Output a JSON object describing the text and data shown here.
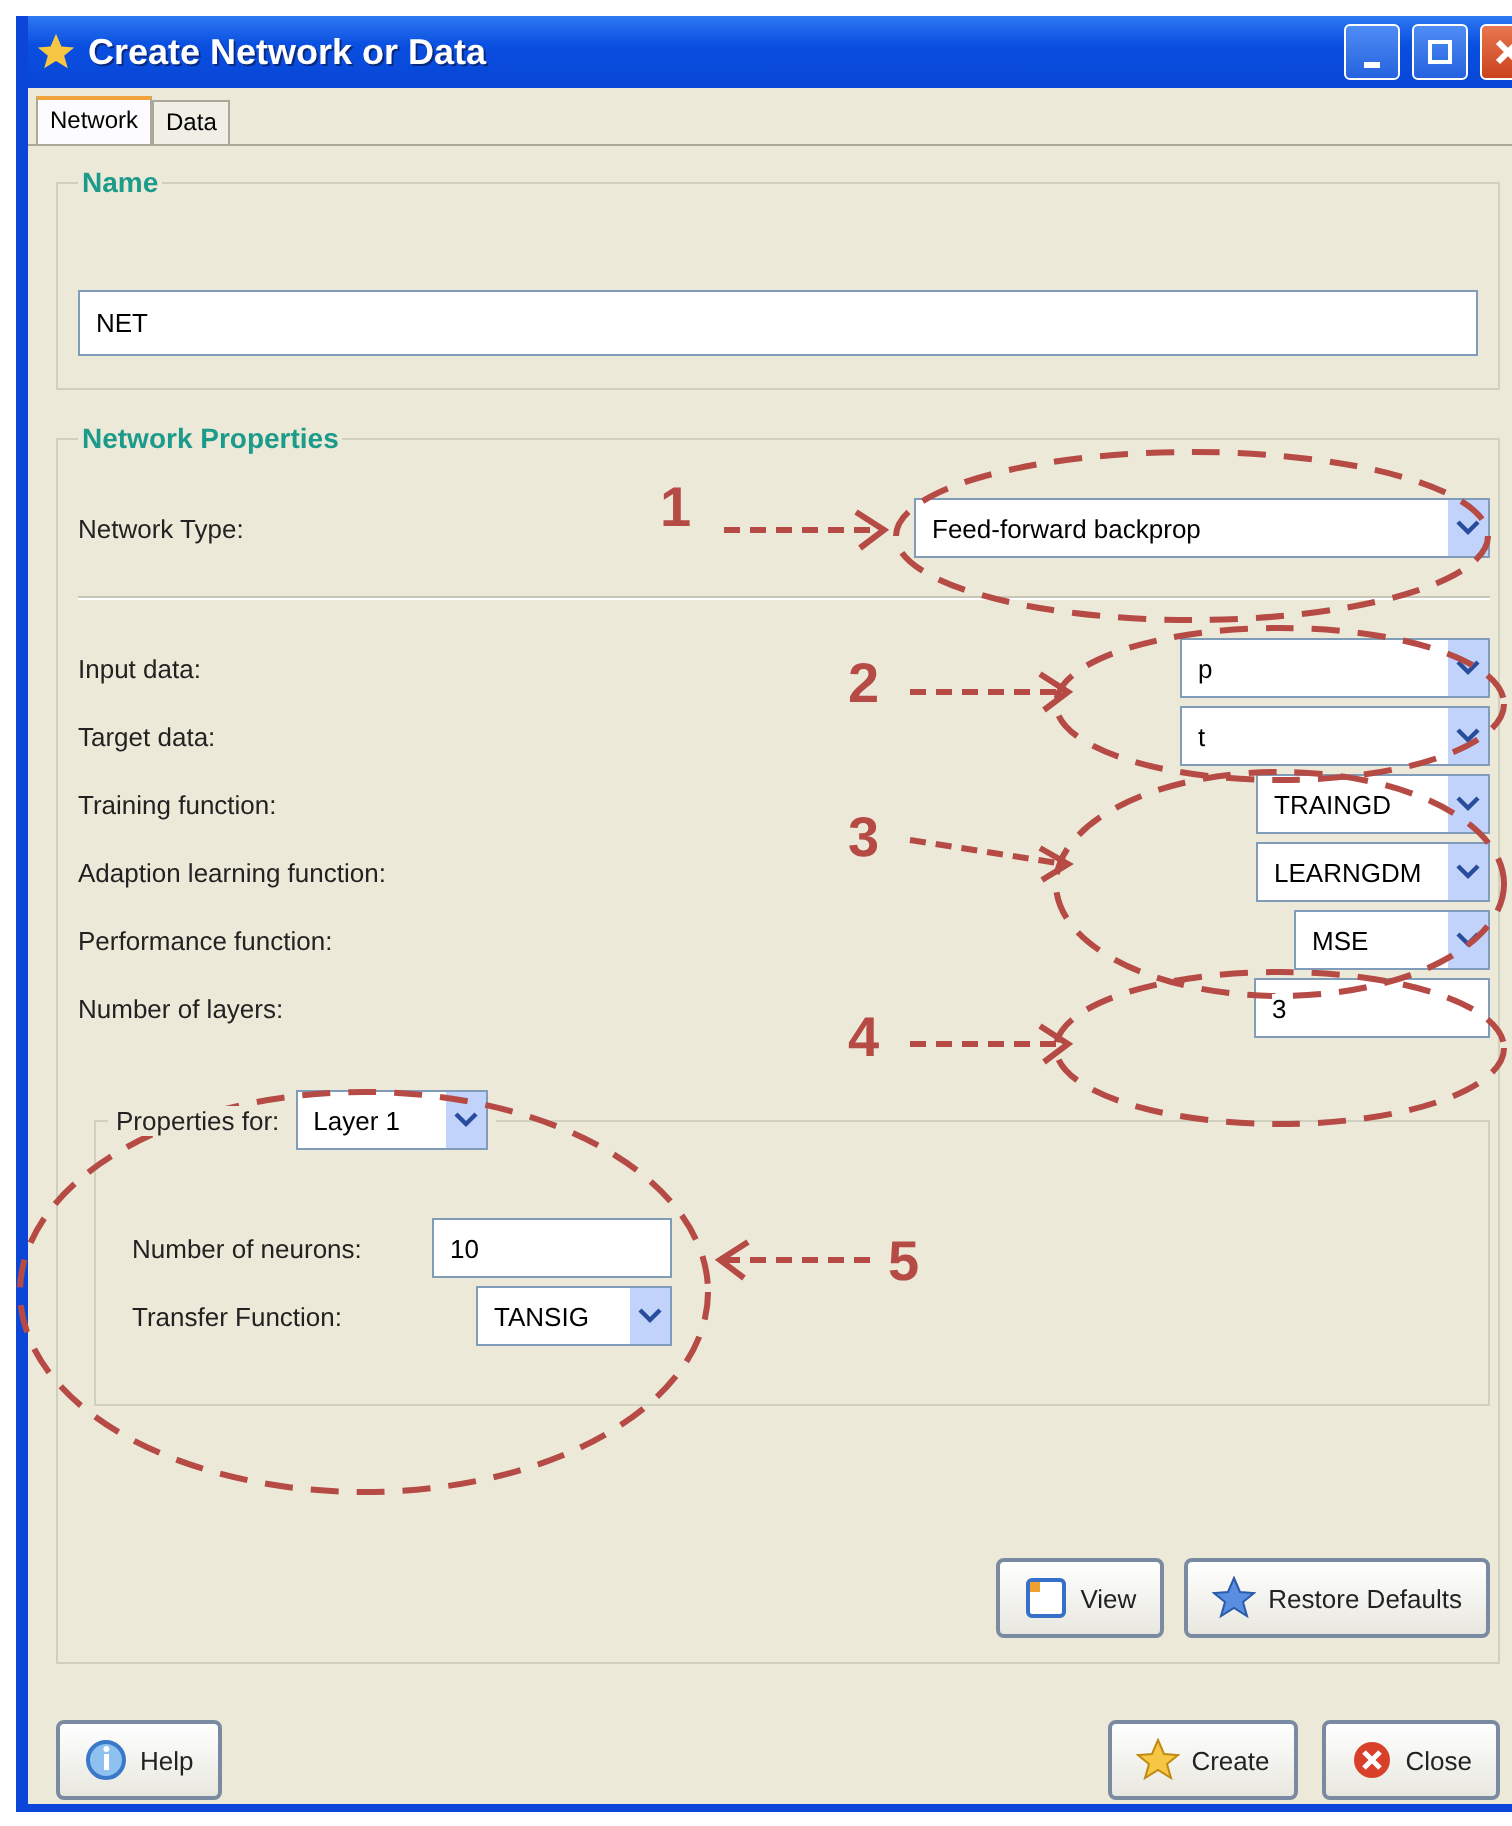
{
  "window": {
    "title": "Create Network or Data"
  },
  "tabs": [
    {
      "label": "Network",
      "selected": true
    },
    {
      "label": "Data",
      "selected": false
    }
  ],
  "name_group": {
    "title": "Name",
    "value": "NET"
  },
  "network_properties": {
    "title": "Network Properties",
    "network_type": {
      "label": "Network Type:",
      "value": "Feed-forward backprop"
    },
    "fields": [
      {
        "label": "Input data:",
        "kind": "dropdown",
        "value": "p"
      },
      {
        "label": "Target data:",
        "kind": "dropdown",
        "value": "t"
      },
      {
        "label": "Training function:",
        "kind": "dropdown",
        "value": "TRAINGD"
      },
      {
        "label": "Adaption learning function:",
        "kind": "dropdown",
        "value": "LEARNGDM"
      },
      {
        "label": "Performance function:",
        "kind": "dropdown",
        "value": "MSE"
      },
      {
        "label": "Number of layers:",
        "kind": "input",
        "value": "3"
      }
    ],
    "layer_properties": {
      "label": "Properties for:",
      "layer": "Layer 1",
      "neurons": {
        "label": "Number of neurons:",
        "value": "10"
      },
      "transfer": {
        "label": "Transfer Function:",
        "value": "TANSIG"
      }
    },
    "buttons": [
      {
        "label": "View",
        "kind": "view"
      },
      {
        "label": "Restore Defaults",
        "kind": "restore"
      }
    ]
  },
  "footer_buttons": [
    {
      "label": "Help",
      "kind": "help"
    },
    {
      "label": "Create",
      "kind": "create"
    },
    {
      "label": "Close",
      "kind": "close"
    }
  ],
  "annotations": [
    {
      "label": "1"
    },
    {
      "label": "2"
    },
    {
      "label": "3"
    },
    {
      "label": "4"
    },
    {
      "label": "5"
    }
  ]
}
